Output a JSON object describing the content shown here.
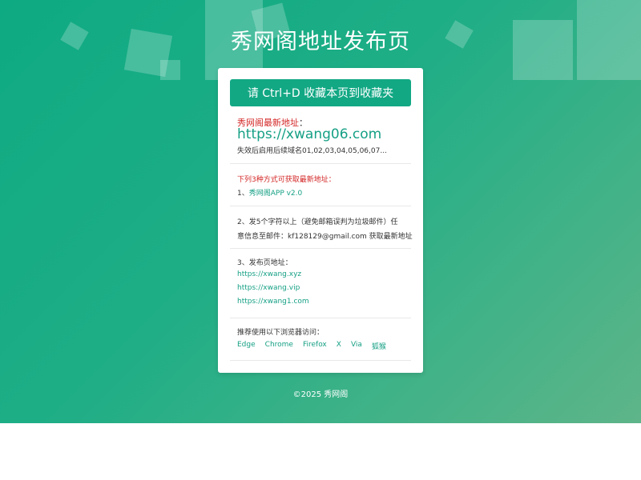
{
  "header": {
    "title": "秀网阁地址发布页"
  },
  "bookmark_button": {
    "label": "请 Ctrl+D 收藏本页到收藏夹"
  },
  "latest": {
    "label": "秀网阁最新地址",
    "colon": "：",
    "url": "https://xwang06.com",
    "note": "失效后启用后续域名01,02,03,04,05,06,07..."
  },
  "methods": {
    "heading": "下列3种方式可获取最新地址：",
    "item1_prefix": "1、",
    "item1_link": "秀网阁APP v2.0",
    "item2_line1": "2、发5个字符以上（避免邮箱误判为垃圾邮件）任",
    "item2_line2": "意信息至邮件：kf128129@gmail.com 获取最新地址",
    "item3_heading": "3、发布页地址：",
    "item3_links": [
      "https://xwang.xyz",
      "https://xwang.vip",
      "https://xwang1.com"
    ]
  },
  "browsers": {
    "heading": "推荐使用以下浏览器访问：",
    "items": [
      "Edge",
      "Chrome",
      "Firefox",
      "X",
      "Via",
      "狐猴"
    ]
  },
  "footer": {
    "text": "©2025 秀网阁"
  },
  "colors": {
    "accent": "#12a884",
    "warning": "#d42727",
    "link": "#16a085"
  }
}
